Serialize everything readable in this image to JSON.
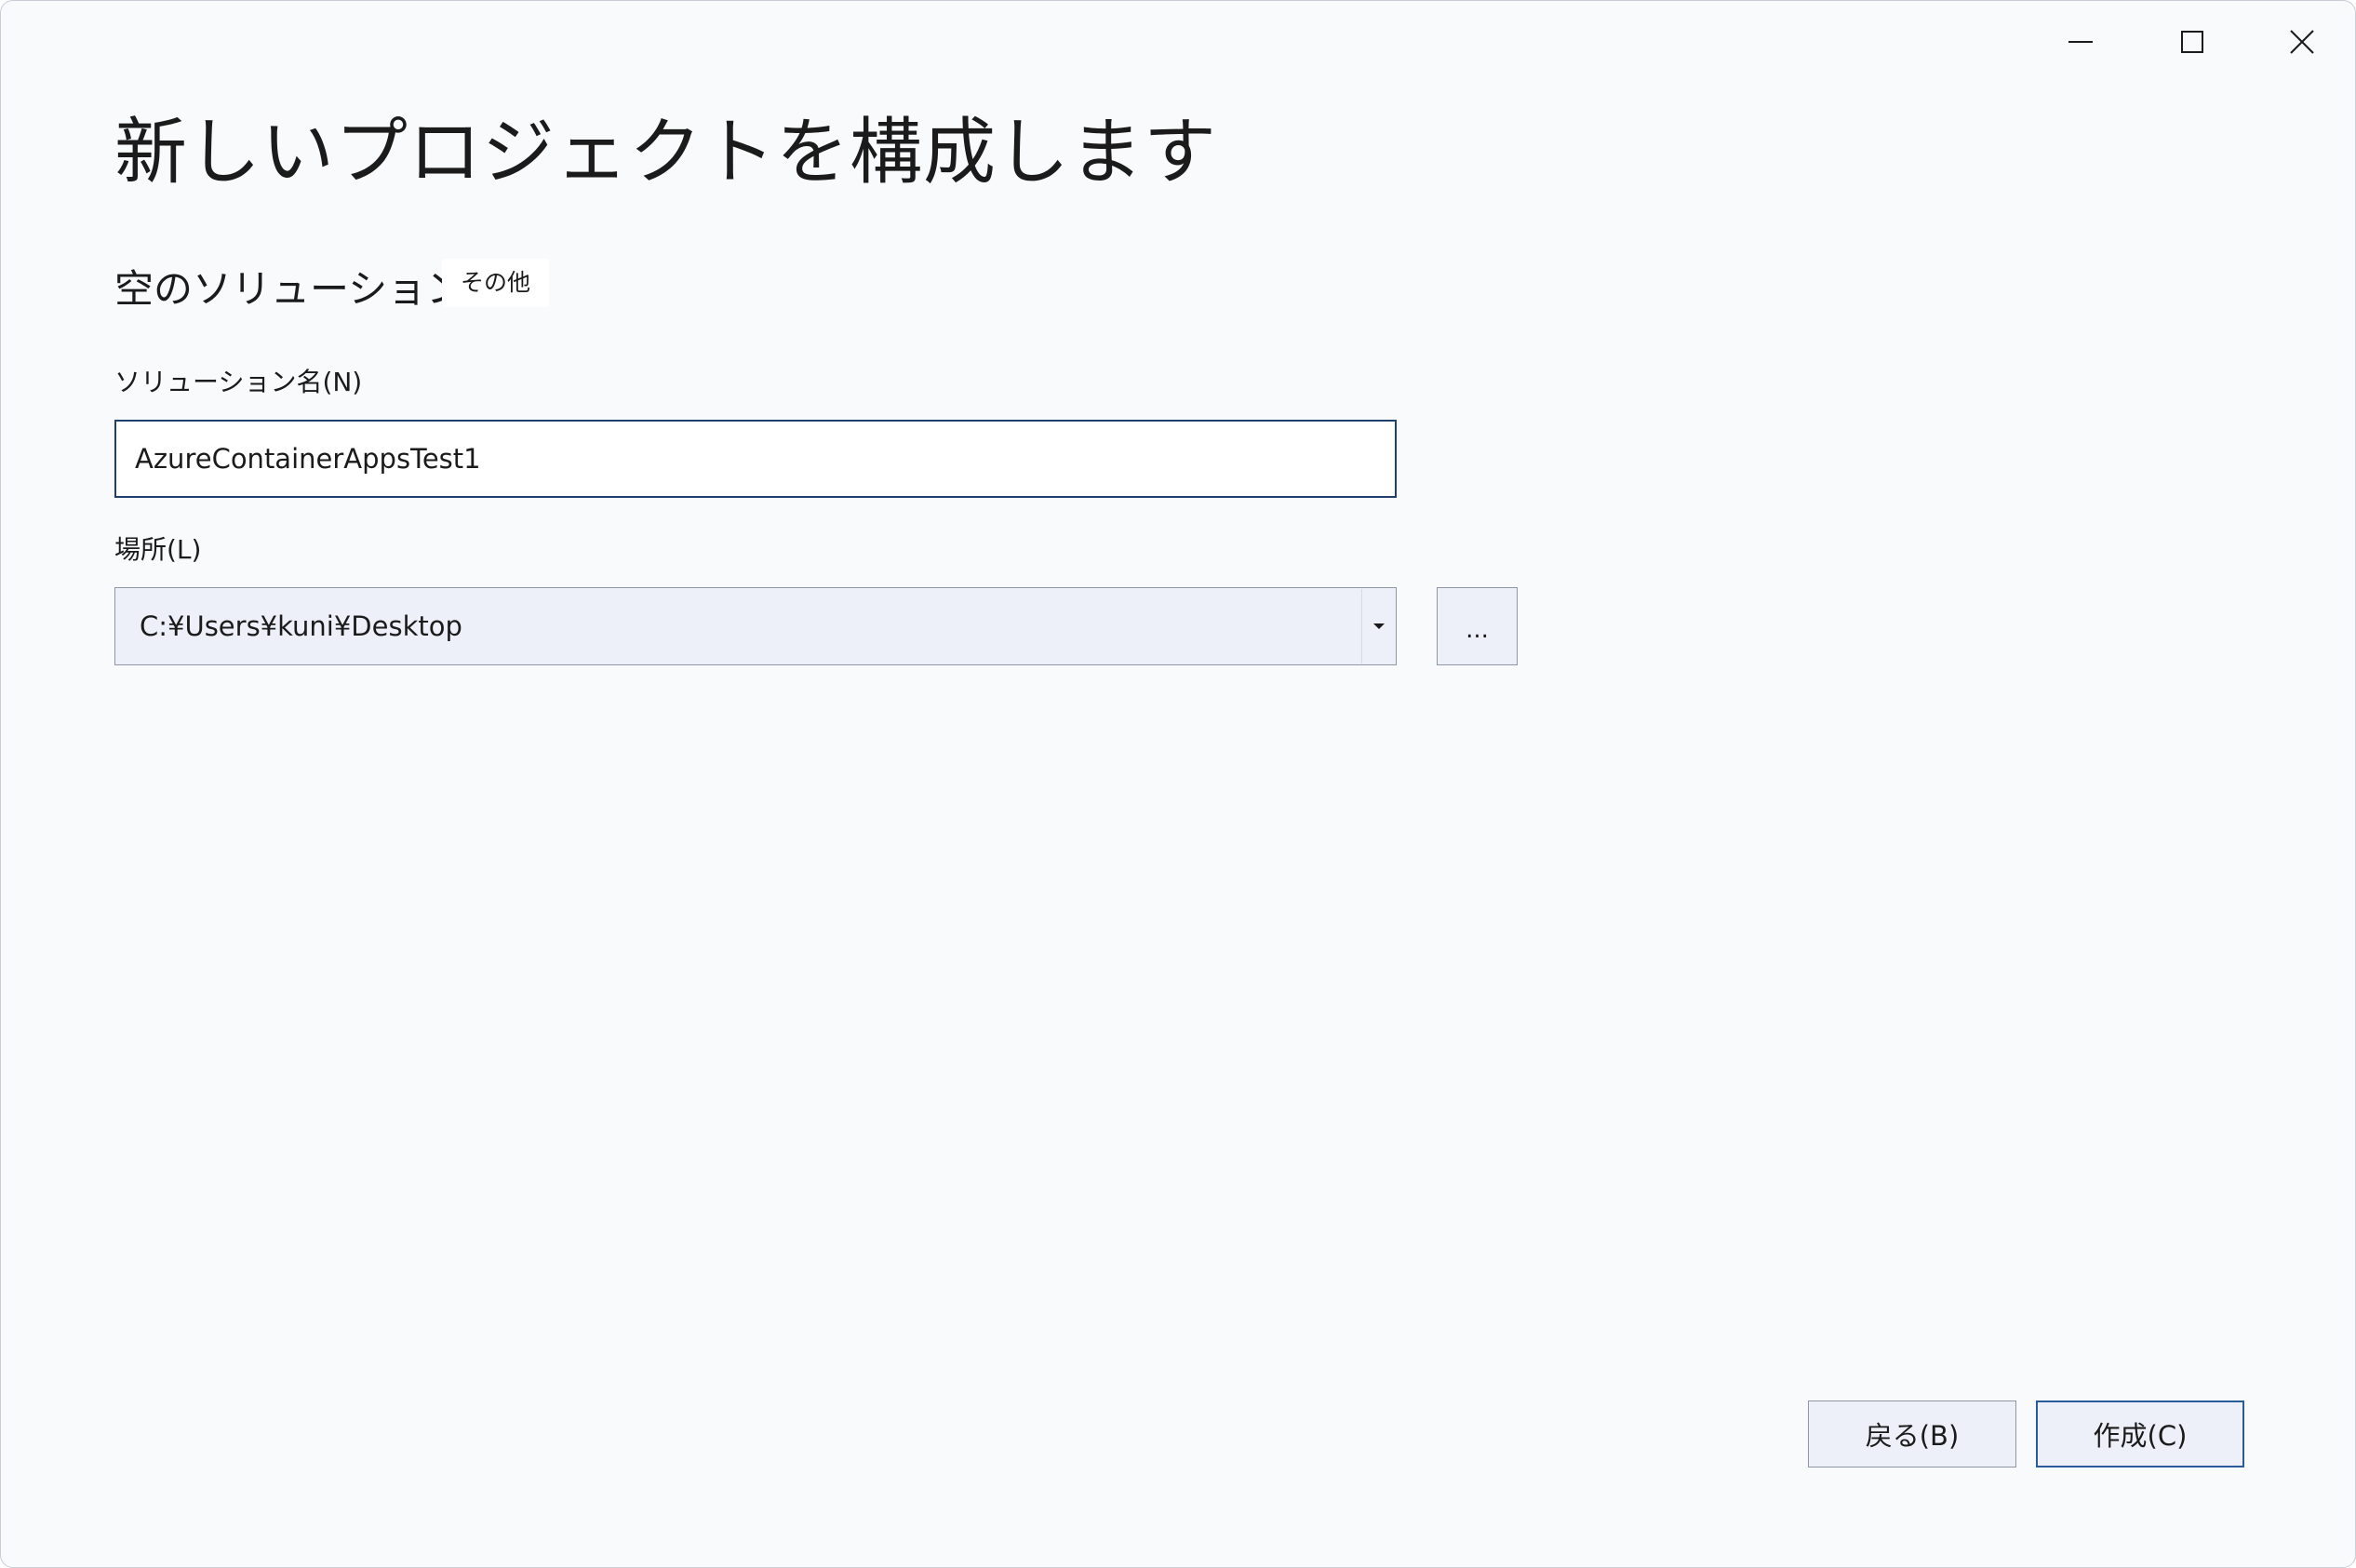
{
  "window": {
    "controls": {
      "minimize_icon": "minimize-icon",
      "maximize_icon": "maximize-icon",
      "close_icon": "close-icon"
    }
  },
  "page": {
    "title": "新しいプロジェクトを構成します",
    "template_name": "空のソリューション",
    "template_tag": "その他"
  },
  "form": {
    "solution_name_label": "ソリューション名(N)",
    "solution_name_value": "AzureContainerAppsTest1",
    "location_label": "場所(L)",
    "location_value": "C:¥Users¥kuni¥Desktop",
    "browse_label": "..."
  },
  "footer": {
    "back_label": "戻る(B)",
    "create_label": "作成(C)"
  },
  "colors": {
    "background": "#f9fafb",
    "input_border_focused": "#1f3f6e",
    "button_background": "#edf0f9",
    "primary_border": "#2a5b9a"
  }
}
